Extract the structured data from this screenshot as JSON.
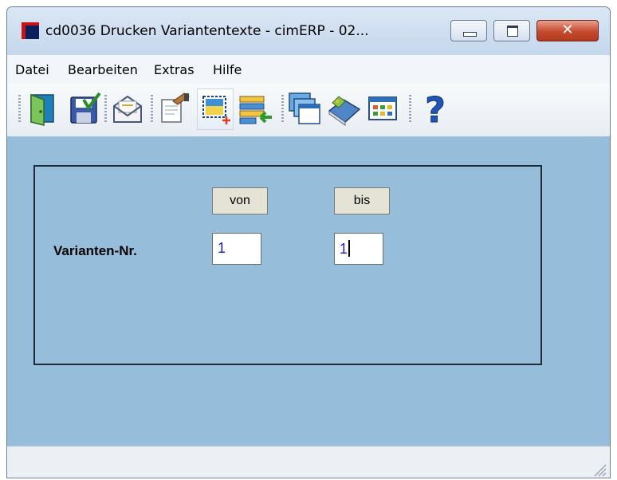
{
  "window": {
    "title": "cd0036 Drucken Variantentexte - cimERP - 02...",
    "close_glyph": "✕"
  },
  "menu": {
    "items": [
      "Datei",
      "Bearbeiten",
      "Extras",
      "Hilfe"
    ]
  },
  "toolbar": {
    "buttons": [
      {
        "icon": "exit-door-icon"
      },
      {
        "icon": "save-check-icon"
      },
      {
        "icon": "mail-envelope-icon"
      },
      {
        "icon": "edit-document-icon"
      },
      {
        "icon": "new-record-icon"
      },
      {
        "icon": "import-list-icon"
      },
      {
        "icon": "windows-stack-icon"
      },
      {
        "icon": "book-tag-icon"
      },
      {
        "icon": "table-grid-icon"
      },
      {
        "icon": "help-icon"
      }
    ],
    "help_glyph": "?"
  },
  "form": {
    "col_from": "von",
    "col_to": "bis",
    "row_label": "Varianten-Nr.",
    "from_value": "1",
    "to_value": "1"
  },
  "colors": {
    "content_bg": "#96bdda",
    "field_text": "#1c1cc8",
    "header_bg": "#e4e3d6"
  }
}
